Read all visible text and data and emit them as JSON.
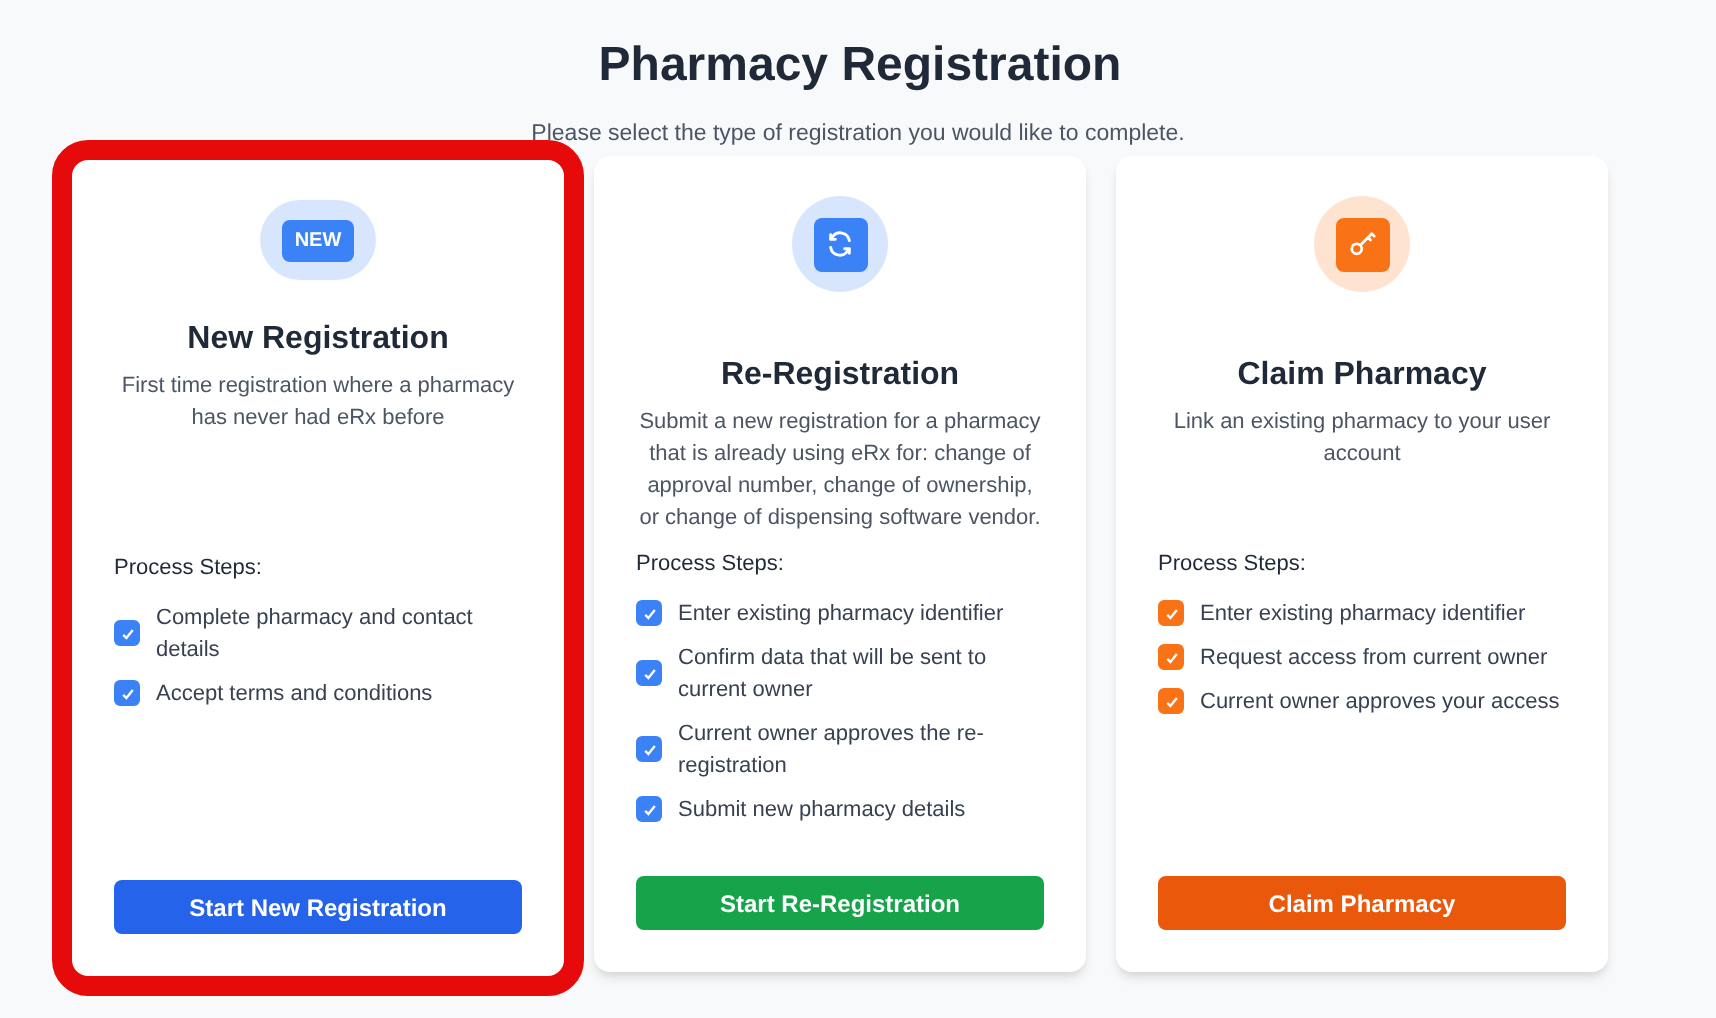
{
  "title": "Pharmacy Registration",
  "subtitle": "Please select the type of registration you would like to complete.",
  "cards": [
    {
      "selected": true,
      "icon": {
        "kind": "badge",
        "label": "NEW"
      },
      "color": "#3b82f6",
      "title": "New Registration",
      "description": "First time registration where a pharmacy has never had eRx before",
      "steps_heading": "Process Steps:",
      "steps": [
        {
          "label": "Complete pharmacy and contact details",
          "checked": true
        },
        {
          "label": "Accept terms and conditions",
          "checked": true
        }
      ],
      "button": {
        "label": "Start New Registration",
        "color": "#2563eb"
      }
    },
    {
      "selected": false,
      "icon": {
        "kind": "refresh"
      },
      "color": "#3b82f6",
      "title": "Re-Registration",
      "description": "Submit a new registration for a pharmacy that is already using eRx for: change of approval number, change of ownership, or change of dispensing software vendor.",
      "steps_heading": "Process Steps:",
      "steps": [
        {
          "label": "Enter existing pharmacy identifier",
          "checked": true
        },
        {
          "label": "Confirm data that will be sent to current owner",
          "checked": true
        },
        {
          "label": "Current owner approves the re-registration",
          "checked": true
        },
        {
          "label": "Submit new pharmacy details",
          "checked": true
        }
      ],
      "button": {
        "label": "Start Re-Registration",
        "color": "#16a34a"
      }
    },
    {
      "selected": false,
      "icon": {
        "kind": "key"
      },
      "color": "#f97316",
      "title": "Claim Pharmacy",
      "description": "Link an existing pharmacy to your user account",
      "steps_heading": "Process Steps:",
      "steps": [
        {
          "label": "Enter existing pharmacy identifier",
          "checked": true
        },
        {
          "label": "Request access from current owner",
          "checked": true
        },
        {
          "label": "Current owner approves your access",
          "checked": true
        }
      ],
      "button": {
        "label": "Claim Pharmacy",
        "color": "#ea580c"
      }
    }
  ]
}
